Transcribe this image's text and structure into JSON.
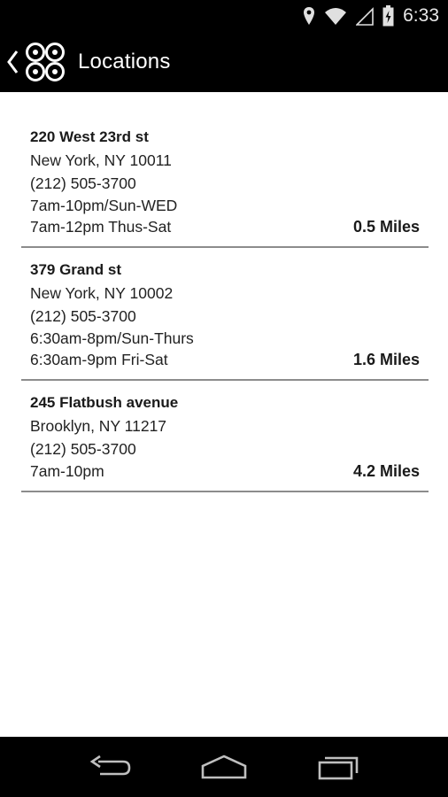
{
  "status_bar": {
    "time": "6:33",
    "icons": [
      "location-icon",
      "wifi-icon",
      "signal-icon",
      "battery-charging-icon"
    ]
  },
  "action_bar": {
    "title": "Locations",
    "up_icon": "chevron-left-icon",
    "logo_icon": "four-rings-logo-icon"
  },
  "locations": [
    {
      "name": "220 West 23rd st",
      "city": "New York, NY 10011",
      "phone": "(212) 505-3700",
      "hours": [
        "7am-10pm/Sun-WED",
        "7am-12pm Thus-Sat"
      ],
      "distance": "0.5 Miles"
    },
    {
      "name": "379 Grand st",
      "city": "New York, NY 10002",
      "phone": "(212) 505-3700",
      "hours": [
        "6:30am-8pm/Sun-Thurs",
        "6:30am-9pm Fri-Sat"
      ],
      "distance": "1.6 Miles"
    },
    {
      "name": "245 Flatbush avenue",
      "city": "Brooklyn, NY 11217",
      "phone": "(212) 505-3700",
      "hours": [
        "7am-10pm"
      ],
      "distance": "4.2 Miles"
    }
  ],
  "nav_bar": {
    "icons": [
      "back-icon",
      "home-icon",
      "recent-apps-icon"
    ]
  },
  "colors": {
    "bar_background": "#000000",
    "content_background": "#ffffff",
    "divider": "#8c8c8c",
    "text": "#1a1a1a"
  }
}
